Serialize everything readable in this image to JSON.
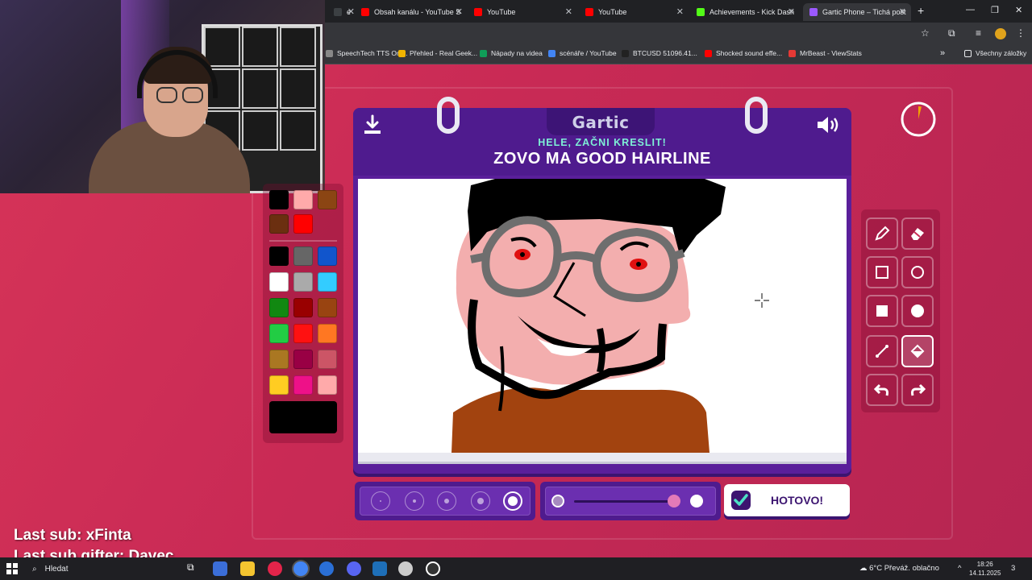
{
  "browser": {
    "tabs": [
      {
        "title": "e",
        "color": "#3c4043",
        "active": false
      },
      {
        "title": "Obsah kanálu - YouTube S",
        "color": "#ff0000",
        "active": false
      },
      {
        "title": "YouTube",
        "color": "#ff0000",
        "active": false
      },
      {
        "title": "YouTube",
        "color": "#ff0000",
        "active": false
      },
      {
        "title": "Achievements - Kick Dash",
        "color": "#53fc18",
        "active": false
      },
      {
        "title": "Gartic Phone – Tichá pošt",
        "color": "#9b59ff",
        "active": true
      }
    ],
    "new_tab": "+",
    "bookmarks": [
      {
        "label": "SpeechTech TTS Onl...",
        "color": "#888888"
      },
      {
        "label": "Přehled - Real Geek...",
        "color": "#f0b400"
      },
      {
        "label": "Nápady na videa",
        "color": "#0f9d58"
      },
      {
        "label": "scénáře / YouTube",
        "color": "#4285f4"
      },
      {
        "label": "BTCUSD 51096.41...",
        "color": "#222222"
      },
      {
        "label": "Shocked sound effe...",
        "color": "#ff0000"
      },
      {
        "label": "MrBeast - ViewStats",
        "color": "#e53935"
      }
    ],
    "all_bookmarks": "Všechny záložky"
  },
  "game": {
    "logo": "Gartic",
    "subtitle": "HELE, ZAČNI KRESLIT!",
    "prompt": "ZOVO MA GOOD HAIRLINE",
    "done_label": "HOTOVO!",
    "timer_elapsed": 0.04,
    "palette": [
      "#000000",
      "#ffaaaa",
      "#8b4513",
      "#6b2f10",
      "#ff0000",
      "#000000",
      "#666666",
      "#1155cc",
      "#ffffff",
      "#aaaaaa",
      "#33ccff",
      "#118811",
      "#990000",
      "#994411",
      "#22cc44",
      "#ff1111",
      "#ff7722",
      "#aa7722",
      "#990044",
      "#cc5566",
      "#ffcc22",
      "#ee1188",
      "#ffaaaa"
    ],
    "current_color": "#000000",
    "tools": [
      "pencil",
      "eraser",
      "rectangle",
      "ellipse",
      "filled-rectangle",
      "filled-ellipse",
      "line",
      "fill-bucket",
      "undo",
      "redo"
    ],
    "active_tool": "fill-bucket",
    "brush_sizes": 5,
    "active_size": 5,
    "opacity_level": 1.0
  },
  "overlay": {
    "last_sub": "Last sub: xFinta",
    "last_gifter": "Last sub gifter: Davec"
  },
  "taskbar": {
    "search": "Hledat",
    "weather": "6°C  Převáž. oblačno",
    "time": "18:26",
    "date": "14.11.2025",
    "notifications": "3"
  }
}
